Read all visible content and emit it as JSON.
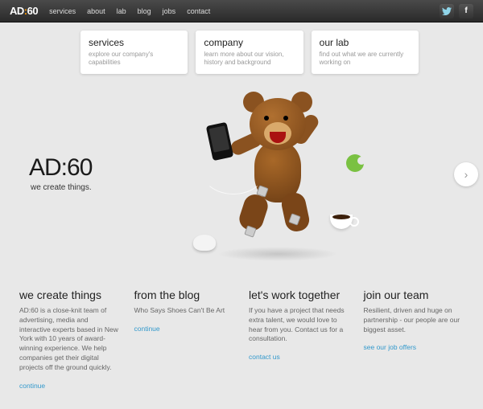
{
  "nav": {
    "logo_ad": "AD",
    "logo_colon": ":",
    "logo_sixty": "60",
    "items": [
      "services",
      "about",
      "lab",
      "blog",
      "jobs",
      "contact"
    ]
  },
  "cards": [
    {
      "title": "services",
      "desc": "explore our company's capabilities"
    },
    {
      "title": "company",
      "desc": "learn more about our vision, history and background"
    },
    {
      "title": "our lab",
      "desc": "find out what we are currently working on"
    }
  ],
  "hero": {
    "logo": "AD:60",
    "tagline": "we create things."
  },
  "columns": [
    {
      "title": "we create things",
      "body": "AD:60 is a close-knit team of advertising, media and interactive experts based in New York with 10 years of award-winning experience. We help companies get their digital projects off the ground quickly.",
      "link": "continue"
    },
    {
      "title": "from the blog",
      "body": "Who Says Shoes Can't Be Art",
      "link": "continue"
    },
    {
      "title": "let's work together",
      "body": "If you have a project that needs extra talent, we would love to hear from you. Contact us for a consultation.",
      "link": "contact us"
    },
    {
      "title": "join our team",
      "body": "Resilient, driven and huge on partnership - our people are our biggest asset.",
      "link": "see our job offers"
    }
  ]
}
